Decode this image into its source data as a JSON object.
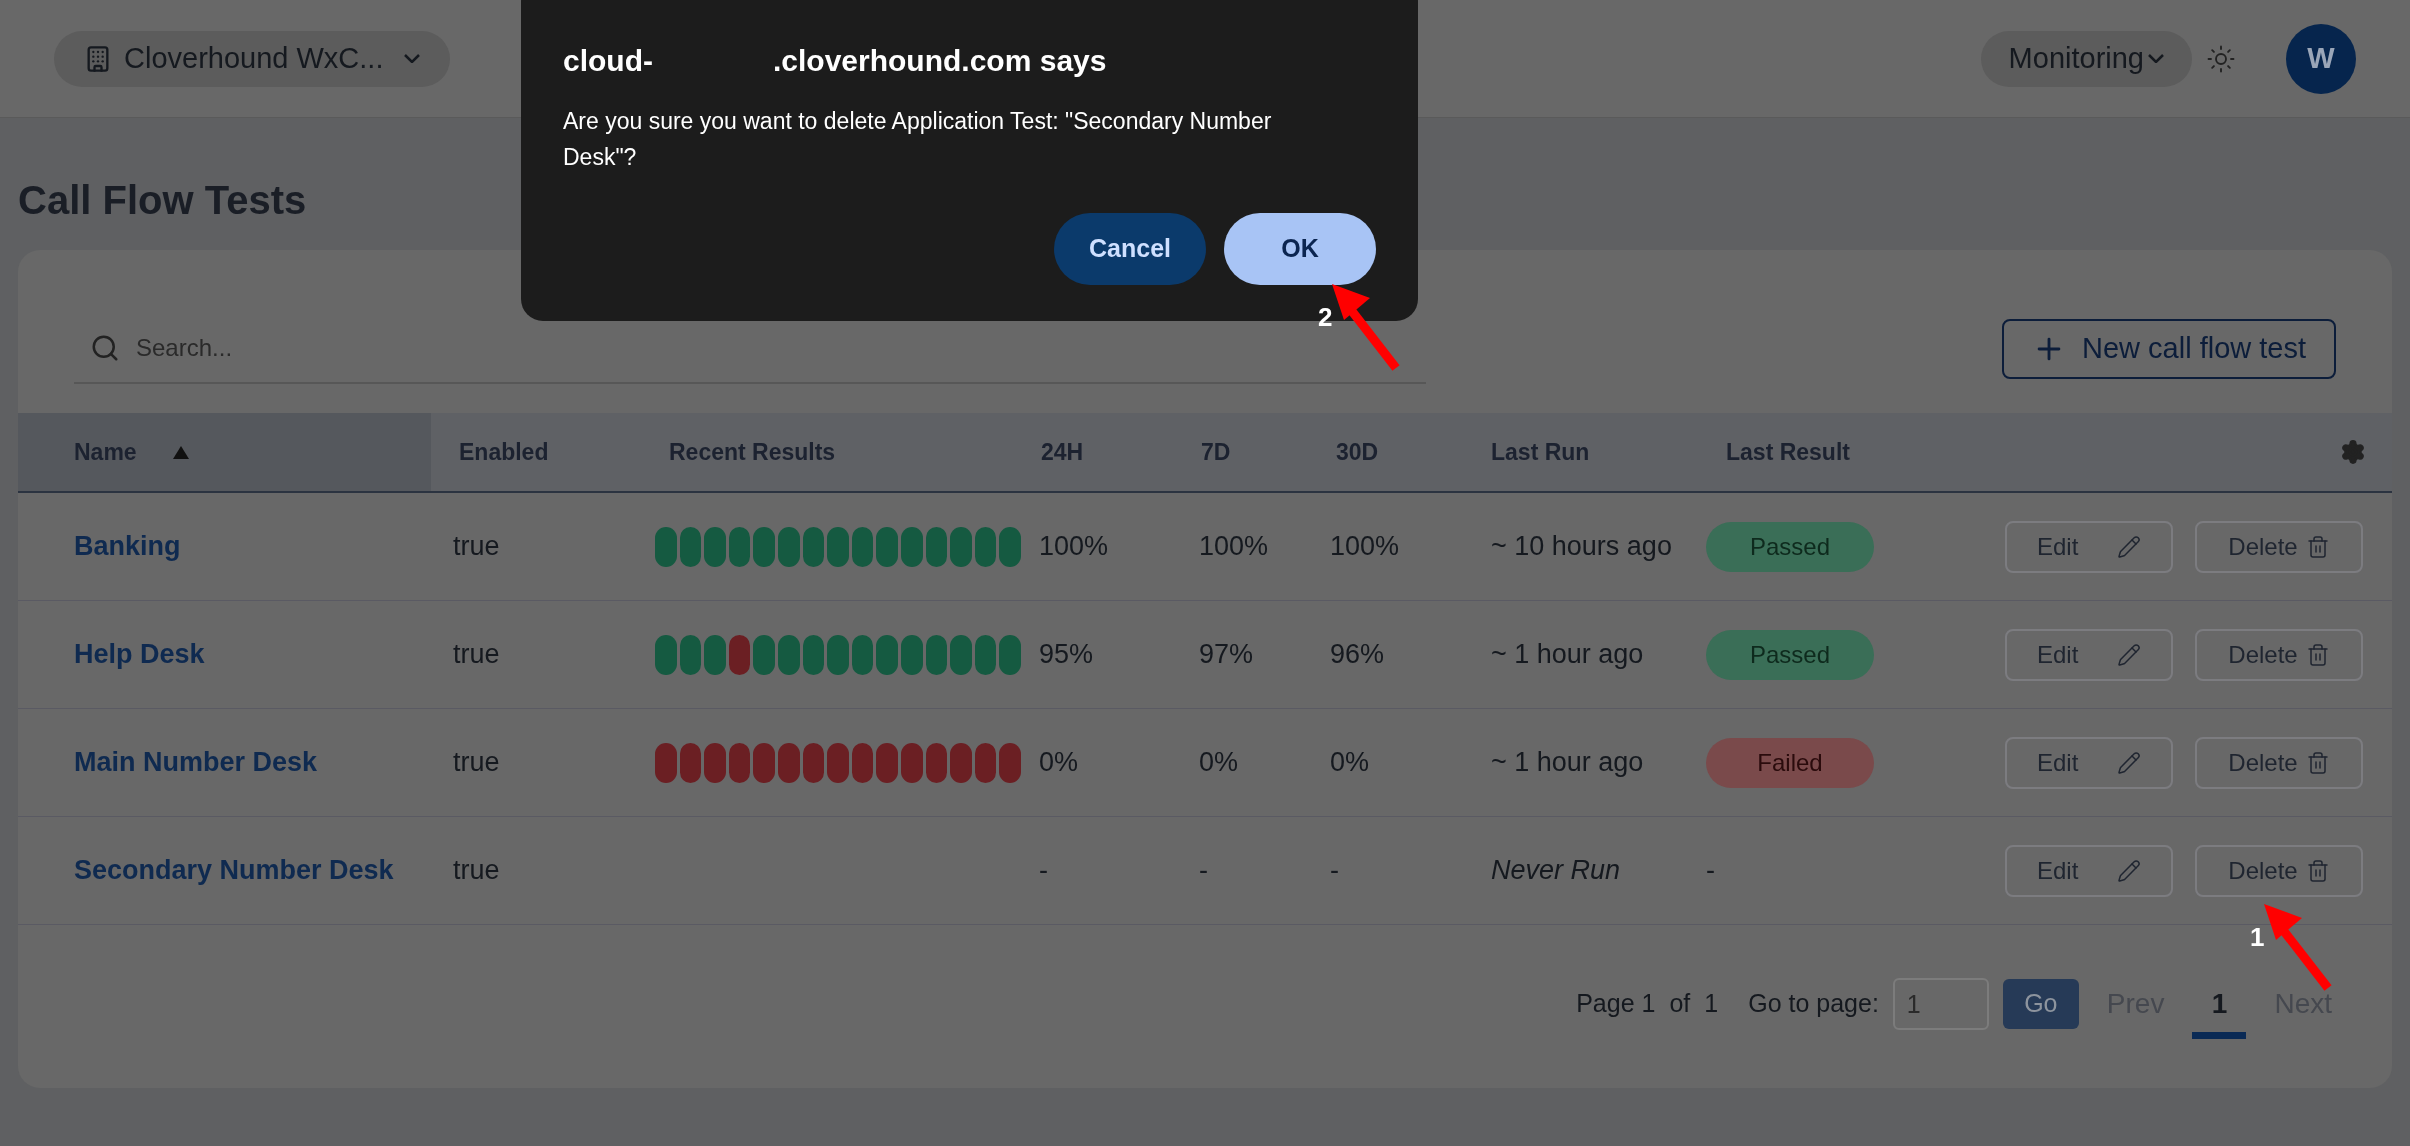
{
  "header": {
    "workspace": "Cloverhound WxC...",
    "nav_menu": "Monitoring",
    "avatar": "W"
  },
  "dialog": {
    "title_start": "cloud-",
    "title_end": ".cloverhound.com says",
    "message": "Are you sure you want to delete Application Test: \"Secondary Number Desk\"?",
    "buttons": [
      {
        "label": "Cancel",
        "kind": "secondary"
      },
      {
        "label": "OK",
        "kind": "primary"
      }
    ]
  },
  "page_title": "Call Flow Tests",
  "search": {
    "placeholder": "Search..."
  },
  "new_button": "New call flow test",
  "columns": [
    {
      "label": "Name",
      "sorted": true
    },
    {
      "label": "Enabled",
      "sorted": false
    },
    {
      "label": "Recent Results",
      "sorted": false
    },
    {
      "label": "24H",
      "sorted": false
    },
    {
      "label": "7D",
      "sorted": false
    },
    {
      "label": "30D",
      "sorted": false
    },
    {
      "label": "Last Run",
      "sorted": false
    },
    {
      "label": "Last Result",
      "sorted": false
    }
  ],
  "rows": [
    {
      "name": "Banking",
      "enabled": "true",
      "results": [
        {
          "failed": false
        },
        {
          "failed": false
        },
        {
          "failed": false
        },
        {
          "failed": false
        },
        {
          "failed": false
        },
        {
          "failed": false
        },
        {
          "failed": false
        },
        {
          "failed": false
        },
        {
          "failed": false
        },
        {
          "failed": false
        },
        {
          "failed": false
        },
        {
          "failed": false
        },
        {
          "failed": false
        },
        {
          "failed": false
        },
        {
          "failed": false
        }
      ],
      "h24": "100%",
      "d7": "100%",
      "d30": "100%",
      "last_run": "~ 10 hours ago",
      "never_run": false,
      "last_result": {
        "label": "Passed",
        "kind": "passed"
      },
      "actions": [
        "Edit",
        "Delete"
      ]
    },
    {
      "name": "Help Desk",
      "enabled": "true",
      "results": [
        {
          "failed": false
        },
        {
          "failed": false
        },
        {
          "failed": false
        },
        {
          "failed": true
        },
        {
          "failed": false
        },
        {
          "failed": false
        },
        {
          "failed": false
        },
        {
          "failed": false
        },
        {
          "failed": false
        },
        {
          "failed": false
        },
        {
          "failed": false
        },
        {
          "failed": false
        },
        {
          "failed": false
        },
        {
          "failed": false
        },
        {
          "failed": false
        }
      ],
      "h24": "95%",
      "d7": "97%",
      "d30": "96%",
      "last_run": "~ 1 hour ago",
      "never_run": false,
      "last_result": {
        "label": "Passed",
        "kind": "passed"
      },
      "actions": [
        "Edit",
        "Delete"
      ]
    },
    {
      "name": "Main Number Desk",
      "enabled": "true",
      "results": [
        {
          "failed": true
        },
        {
          "failed": true
        },
        {
          "failed": true
        },
        {
          "failed": true
        },
        {
          "failed": true
        },
        {
          "failed": true
        },
        {
          "failed": true
        },
        {
          "failed": true
        },
        {
          "failed": true
        },
        {
          "failed": true
        },
        {
          "failed": true
        },
        {
          "failed": true
        },
        {
          "failed": true
        },
        {
          "failed": true
        },
        {
          "failed": true
        }
      ],
      "h24": "0%",
      "d7": "0%",
      "d30": "0%",
      "last_run": "~ 1 hour ago",
      "never_run": false,
      "last_result": {
        "label": "Failed",
        "kind": "failed"
      },
      "actions": [
        "Edit",
        "Delete"
      ]
    },
    {
      "name": "Secondary Number Desk",
      "enabled": "true",
      "results": [],
      "h24": "-",
      "d7": "-",
      "d30": "-",
      "last_run": "Never Run",
      "never_run": true,
      "last_result": {
        "label": "-",
        "kind": "none"
      },
      "actions": [
        "Edit",
        "Delete"
      ]
    }
  ],
  "pagination": {
    "page_label": "Page 1",
    "of_label": "of",
    "total": "1",
    "goto_label": "Go to page:",
    "goto_value": "1",
    "go_button": "Go",
    "prev": "Prev",
    "next": "Next",
    "prev_disabled": true,
    "next_disabled": true,
    "pages": [
      {
        "label": "1",
        "selected": true
      }
    ]
  },
  "annotations": [
    {
      "label": "2"
    },
    {
      "label": "1"
    }
  ]
}
